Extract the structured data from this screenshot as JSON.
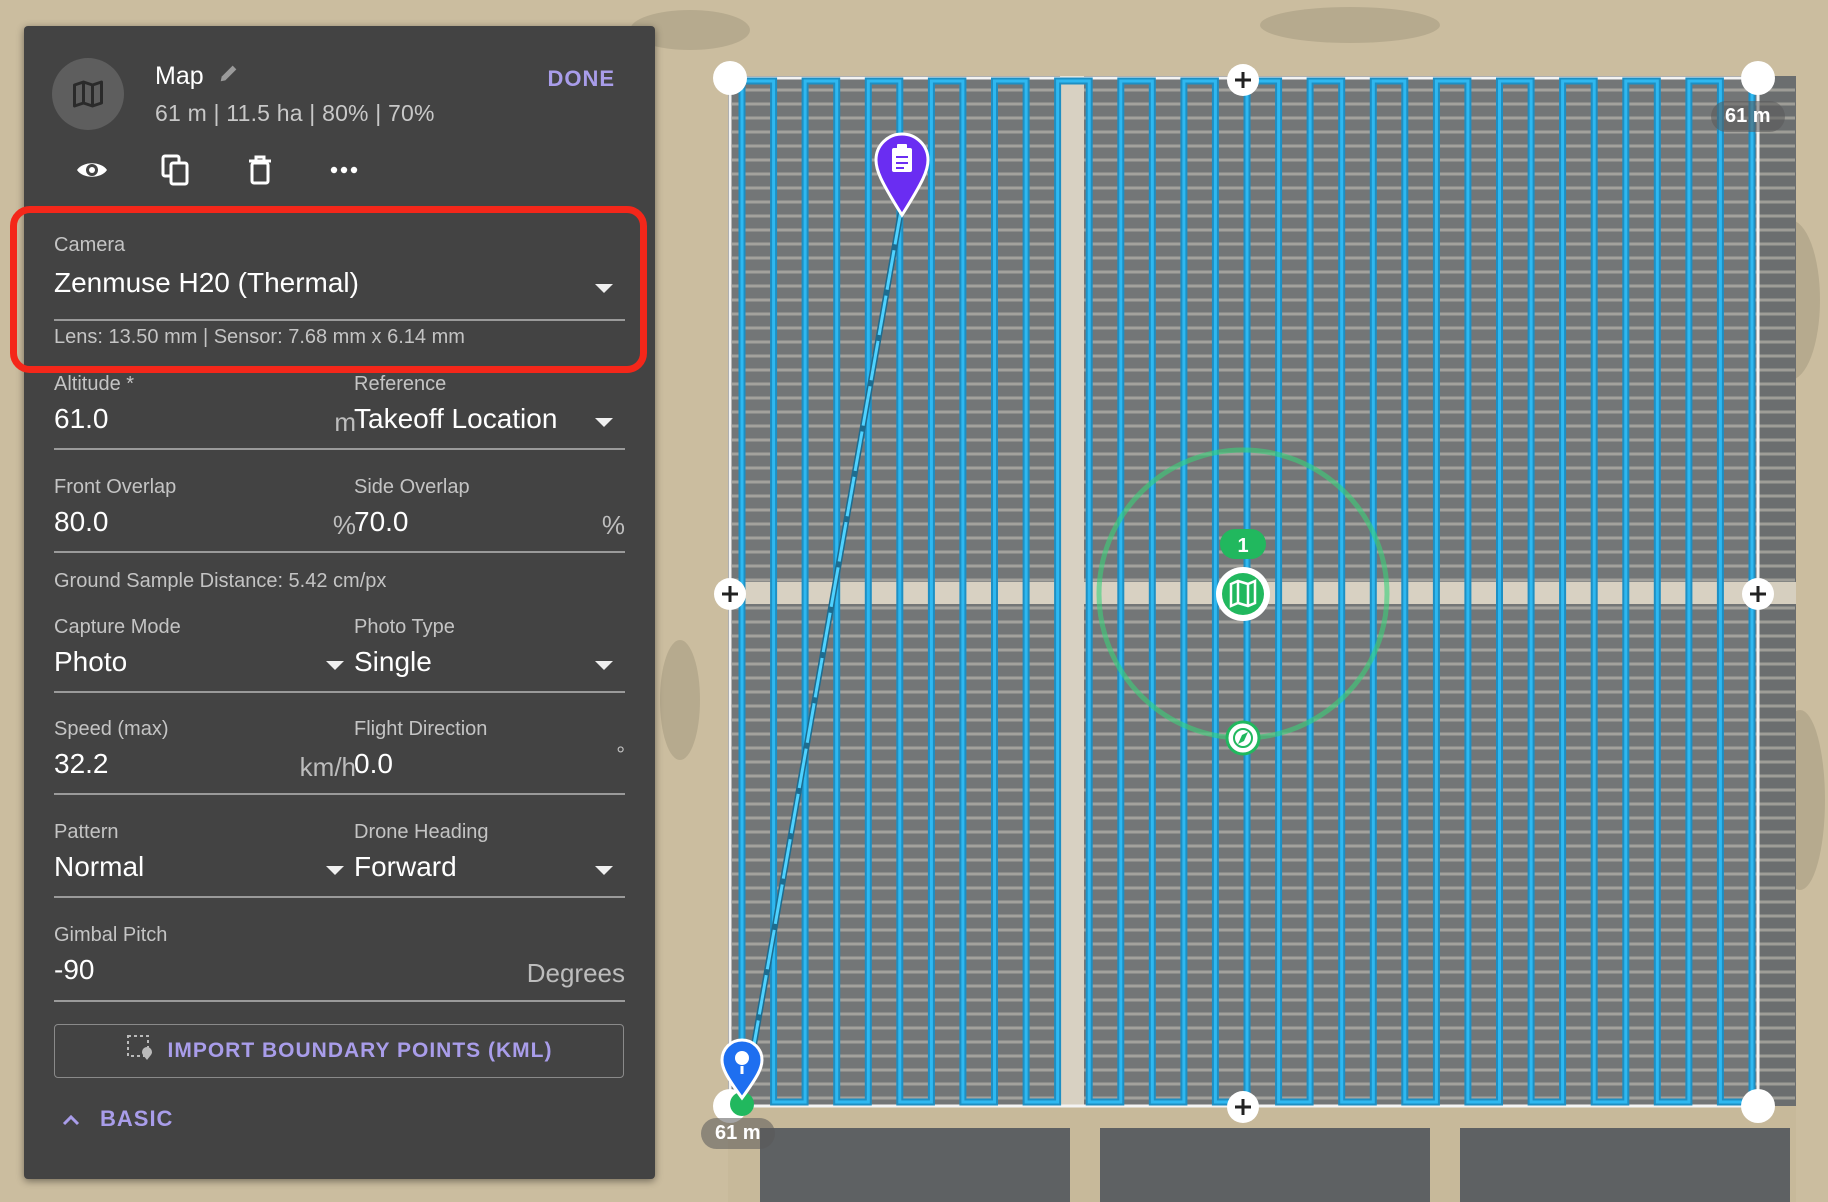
{
  "header": {
    "title": "Map",
    "subtitle": "61 m | 11.5 ha | 80% | 70%",
    "done_label": "DONE"
  },
  "toolbar": {
    "icons": [
      "eye-icon",
      "copy-icon",
      "trash-icon",
      "more-icon"
    ]
  },
  "camera": {
    "label": "Camera",
    "value": "Zenmuse H20 (Thermal)",
    "info": "Lens: 13.50 mm | Sensor: 7.68 mm x 6.14 mm"
  },
  "altitude": {
    "label": "Altitude *",
    "value": "61.0",
    "unit": "m"
  },
  "reference": {
    "label": "Reference",
    "value": "Takeoff Location"
  },
  "front_overlap": {
    "label": "Front Overlap",
    "value": "80.0",
    "unit": "%"
  },
  "side_overlap": {
    "label": "Side Overlap",
    "value": "70.0",
    "unit": "%"
  },
  "gsd": "Ground Sample Distance: 5.42 cm/px",
  "capture_mode": {
    "label": "Capture Mode",
    "value": "Photo"
  },
  "photo_type": {
    "label": "Photo Type",
    "value": "Single"
  },
  "speed": {
    "label": "Speed (max)",
    "value": "32.2",
    "unit": "km/h"
  },
  "flight_direction": {
    "label": "Flight Direction",
    "value": "0.0",
    "unit": "°"
  },
  "pattern": {
    "label": "Pattern",
    "value": "Normal"
  },
  "drone_heading": {
    "label": "Drone Heading",
    "value": "Forward"
  },
  "gimbal_pitch": {
    "label": "Gimbal Pitch",
    "value": "-90",
    "unit": "Degrees"
  },
  "import_button": "IMPORT BOUNDARY POINTS (KML)",
  "basic_toggle": "BASIC",
  "map": {
    "scale_top_right": "61 m",
    "scale_bottom_left": "61 m",
    "waypoint_number": "1",
    "flight_line_color": "#2fb8f0",
    "accent_color": "#a99dea",
    "highlight_color": "#f4271a"
  }
}
